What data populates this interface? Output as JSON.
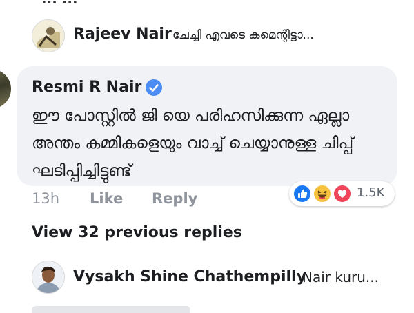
{
  "top_fragment": "...  ...",
  "comments": {
    "rajeev": {
      "avatar_icon": "user-avatar-photo",
      "name": "Rajeev Nair",
      "snippet": "ചേച്ചി എവടെ കമെന്റിട്ടാ..."
    },
    "resmi": {
      "avatar_icon": "user-avatar-photo",
      "name": "Resmi R Nair",
      "verified_icon": "verified-badge-icon",
      "text": "ഈ പോസ്റ്റിൽ ജി യെ പരിഹസിക്കുന്ന ഏല്ലാ അന്തം കമ്മികളെയും വാച്ച് ചെയ്യാനുള്ള ചിപ്പ് ഘടിപ്പിച്ചിട്ടുണ്ട്",
      "time": "13h",
      "like_label": "Like",
      "reply_label": "Reply",
      "reactions": {
        "icons": [
          "like-reaction-icon",
          "haha-reaction-icon",
          "love-reaction-icon"
        ],
        "count": "1.5K"
      }
    },
    "view_previous": "View 32 previous replies",
    "vysakh": {
      "avatar_icon": "user-avatar-photo",
      "name": "Vysakh Shine Chathempilly",
      "snippet": "Nair kuru..."
    }
  },
  "colors": {
    "bubble_bg": "#f0f2f5",
    "meta_text": "#90949c",
    "verified_blue": "#4b8cf5",
    "like_blue": "#1877f2",
    "haha_yellow": "#f7c33f",
    "love_red": "#f0445a"
  }
}
